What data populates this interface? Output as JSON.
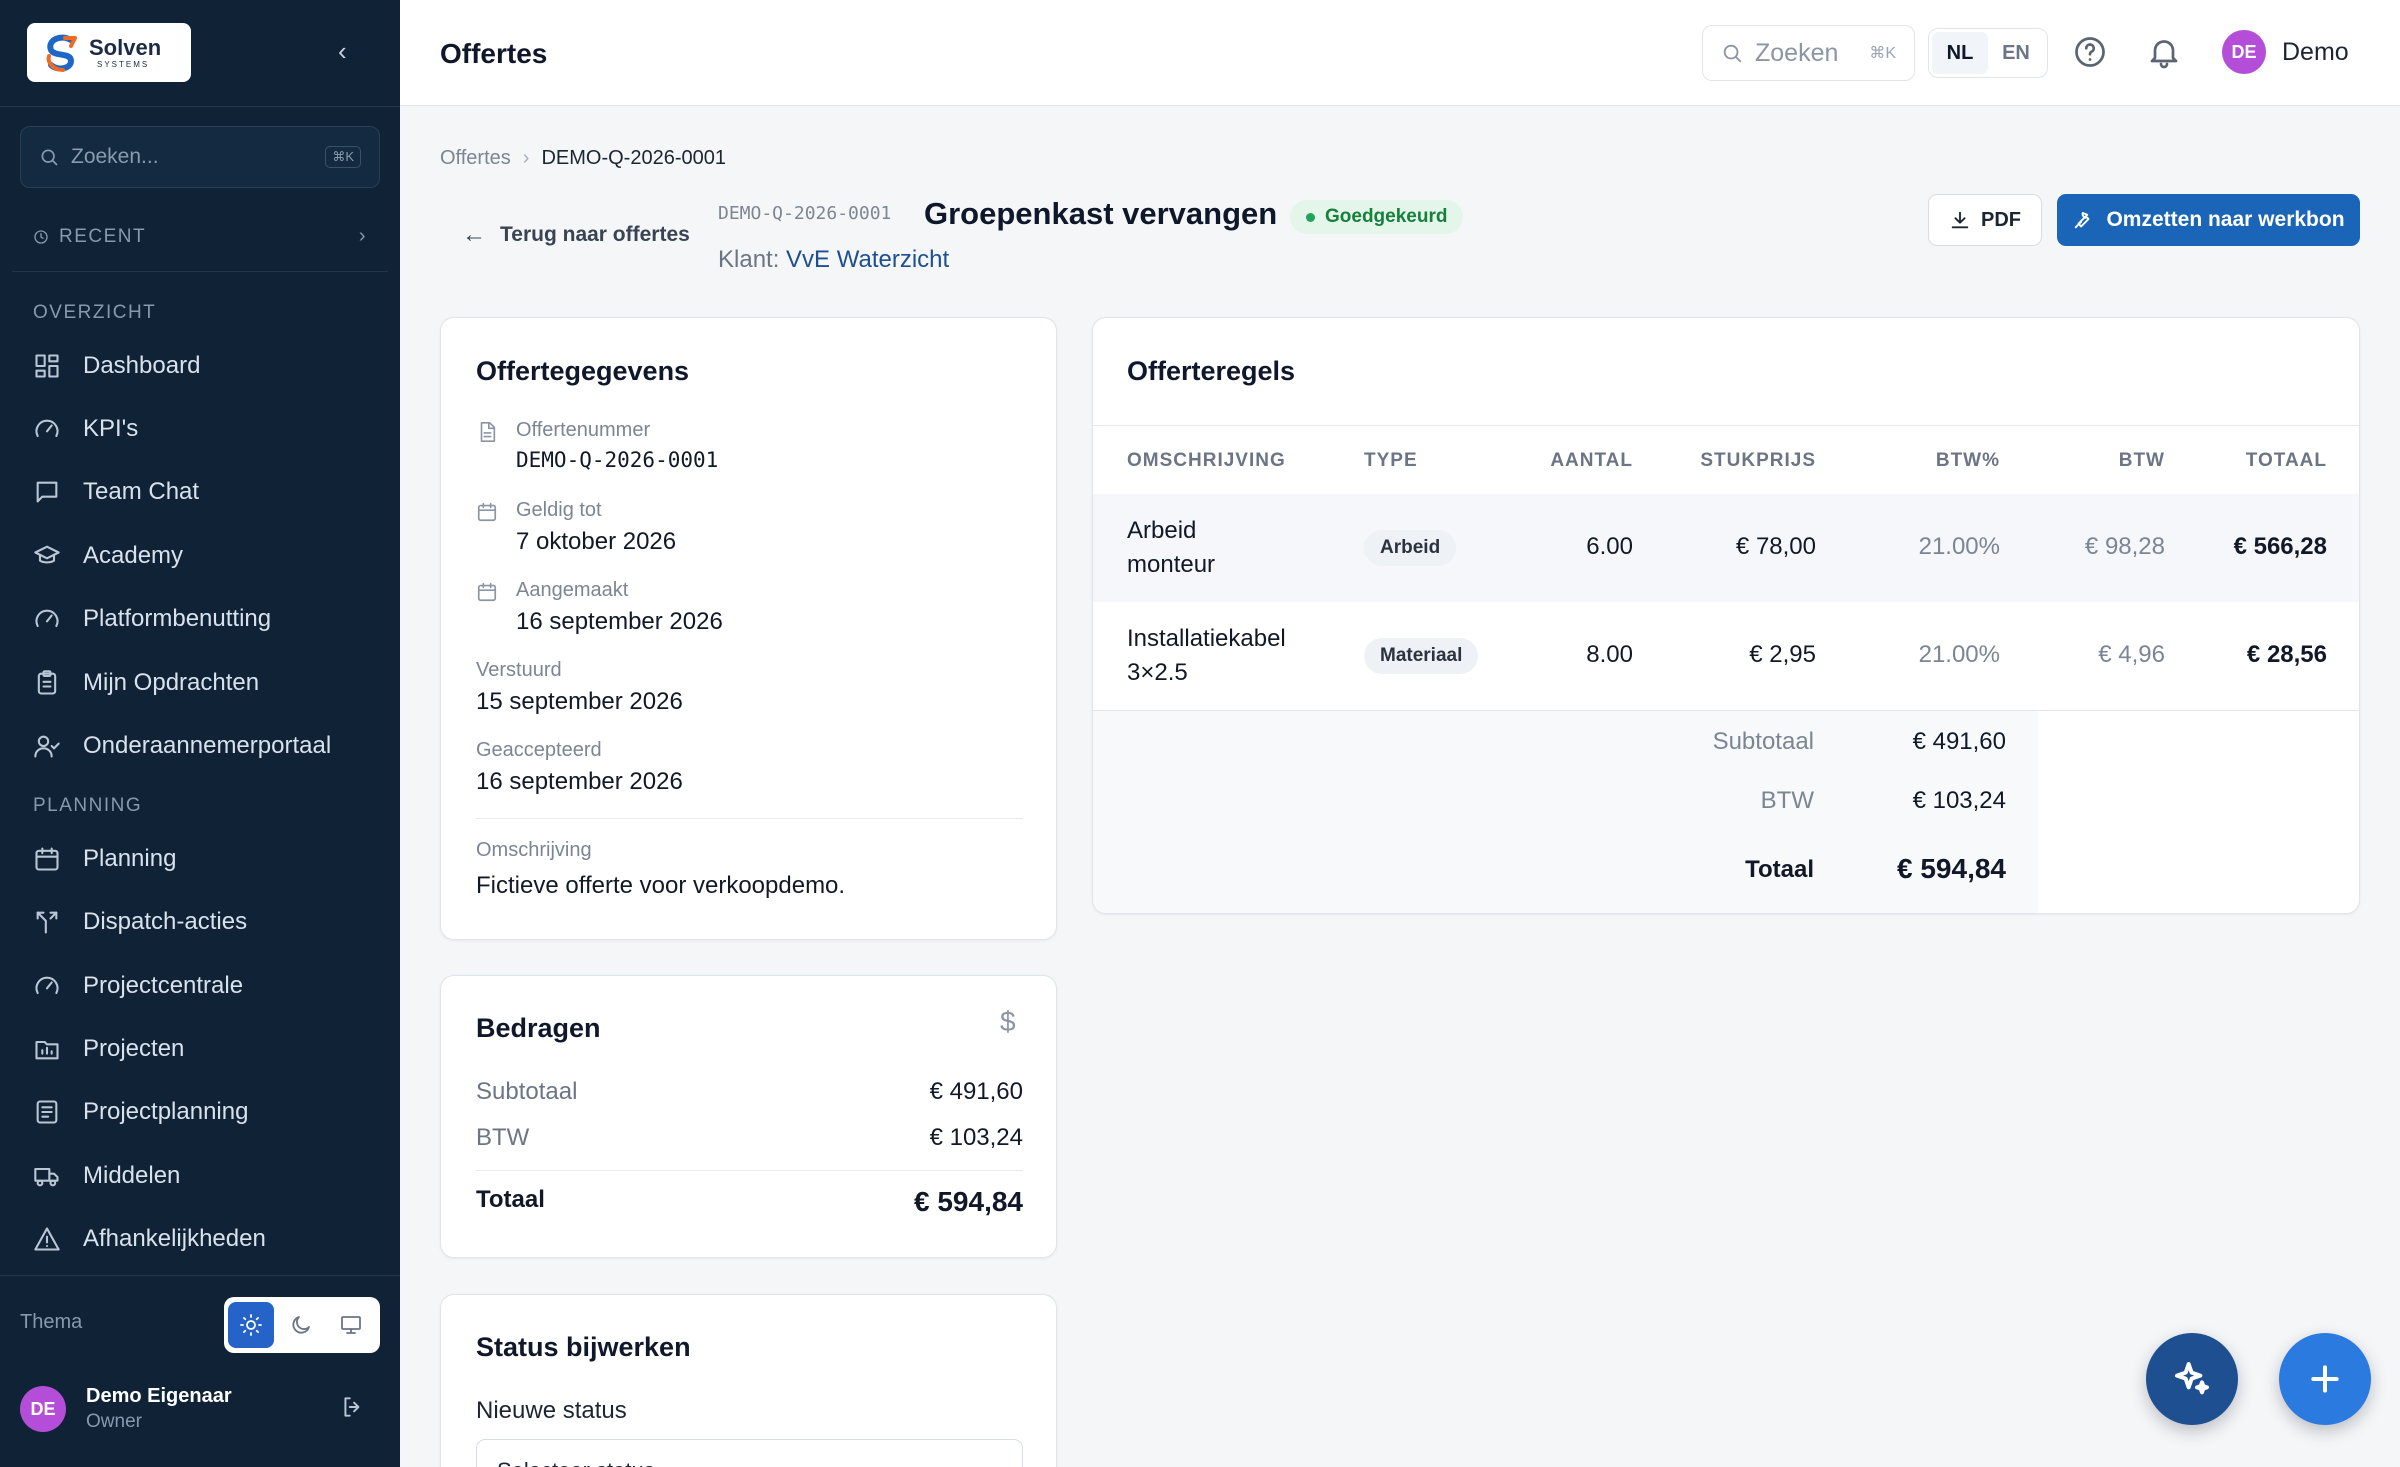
{
  "colors": {
    "sidebar_bg": "#0f2236",
    "primary": "#1a65b8",
    "status_green": "#17803d",
    "avatar": "#b44ed8",
    "link": "#1d4f91"
  },
  "sidebar": {
    "logo_text": "Solven",
    "logo_subtext": "SYSTEMS",
    "search_placeholder": "Zoeken...",
    "search_shortcut": "⌘K",
    "recent_label": "RECENT",
    "sections": [
      {
        "label": "OVERZICHT",
        "items": [
          {
            "label": "Dashboard",
            "icon": "grid-icon"
          },
          {
            "label": "KPI's",
            "icon": "gauge-icon"
          },
          {
            "label": "Team Chat",
            "icon": "chat-icon"
          },
          {
            "label": "Academy",
            "icon": "graduation-cap-icon"
          },
          {
            "label": "Platformbenutting",
            "icon": "gauge-icon"
          },
          {
            "label": "Mijn Opdrachten",
            "icon": "clipboard-icon"
          },
          {
            "label": "Onderaannemerportaal",
            "icon": "user-check-icon"
          }
        ]
      },
      {
        "label": "PLANNING",
        "items": [
          {
            "label": "Planning",
            "icon": "calendar-icon"
          },
          {
            "label": "Dispatch-acties",
            "icon": "split-arrow-icon"
          },
          {
            "label": "Projectcentrale",
            "icon": "gauge-icon"
          },
          {
            "label": "Projecten",
            "icon": "folder-chart-icon"
          },
          {
            "label": "Projectplanning",
            "icon": "list-doc-icon"
          },
          {
            "label": "Middelen",
            "icon": "truck-icon"
          },
          {
            "label": "Afhankelijkheden",
            "icon": "warning-icon"
          }
        ]
      }
    ],
    "theme_label": "Thema",
    "user": {
      "initials": "DE",
      "name": "Demo Eigenaar",
      "role": "Owner"
    }
  },
  "topbar": {
    "title": "Offertes",
    "search_placeholder": "Zoeken",
    "search_shortcut": "⌘K",
    "lang_nl": "NL",
    "lang_en": "EN",
    "user_initials": "DE",
    "user_name": "Demo"
  },
  "breadcrumb": {
    "parent": "Offertes",
    "current": "DEMO-Q-2026-0001"
  },
  "header": {
    "back_label": "Terug naar offertes",
    "quote_code": "DEMO-Q-2026-0001",
    "title": "Groepenkast vervangen",
    "status": "Goedgekeurd",
    "klant_label": "Klant:",
    "klant_name": "VvE Waterzicht",
    "pdf_label": "PDF",
    "convert_label": "Omzetten naar werkbon"
  },
  "details": {
    "title": "Offertegegevens",
    "offertenummer_label": "Offertenummer",
    "offertenummer": "DEMO-Q-2026-0001",
    "geldig_label": "Geldig tot",
    "geldig": "7 oktober 2026",
    "aangemaakt_label": "Aangemaakt",
    "aangemaakt": "16 september 2026",
    "verstuurd_label": "Verstuurd",
    "verstuurd": "15 september 2026",
    "geaccepteerd_label": "Geaccepteerd",
    "geaccepteerd": "16 september 2026",
    "omschrijving_label": "Omschrijving",
    "omschrijving": "Fictieve offerte voor verkoopdemo."
  },
  "amounts": {
    "title": "Bedragen",
    "currency_symbol": "$",
    "subtotaal_label": "Subtotaal",
    "subtotaal": "€ 491,60",
    "btw_label": "BTW",
    "btw": "€ 103,24",
    "totaal_label": "Totaal",
    "totaal": "€ 594,84"
  },
  "status_update": {
    "title": "Status bijwerken",
    "new_status_label": "Nieuwe status",
    "select_placeholder": "Selecteer status"
  },
  "lines": {
    "title": "Offerteregels",
    "columns": [
      "OMSCHRIJVING",
      "TYPE",
      "AANTAL",
      "STUKPRIJS",
      "BTW%",
      "BTW",
      "TOTAAL"
    ],
    "rows": [
      {
        "desc1": "Arbeid",
        "desc2": "monteur",
        "type": "Arbeid",
        "aantal": "6.00",
        "stukprijs": "€ 78,00",
        "btw_pct": "21.00%",
        "btw": "€ 98,28",
        "totaal": "€ 566,28"
      },
      {
        "desc1": "Installatiekabel",
        "desc2": "3×2.5",
        "type": "Materiaal",
        "aantal": "8.00",
        "stukprijs": "€ 2,95",
        "btw_pct": "21.00%",
        "btw": "€ 4,96",
        "totaal": "€ 28,56"
      }
    ],
    "subtotaal_label": "Subtotaal",
    "subtotaal": "€ 491,60",
    "btw_label": "BTW",
    "btw": "€ 103,24",
    "totaal_label": "Totaal",
    "totaal": "€ 594,84"
  }
}
